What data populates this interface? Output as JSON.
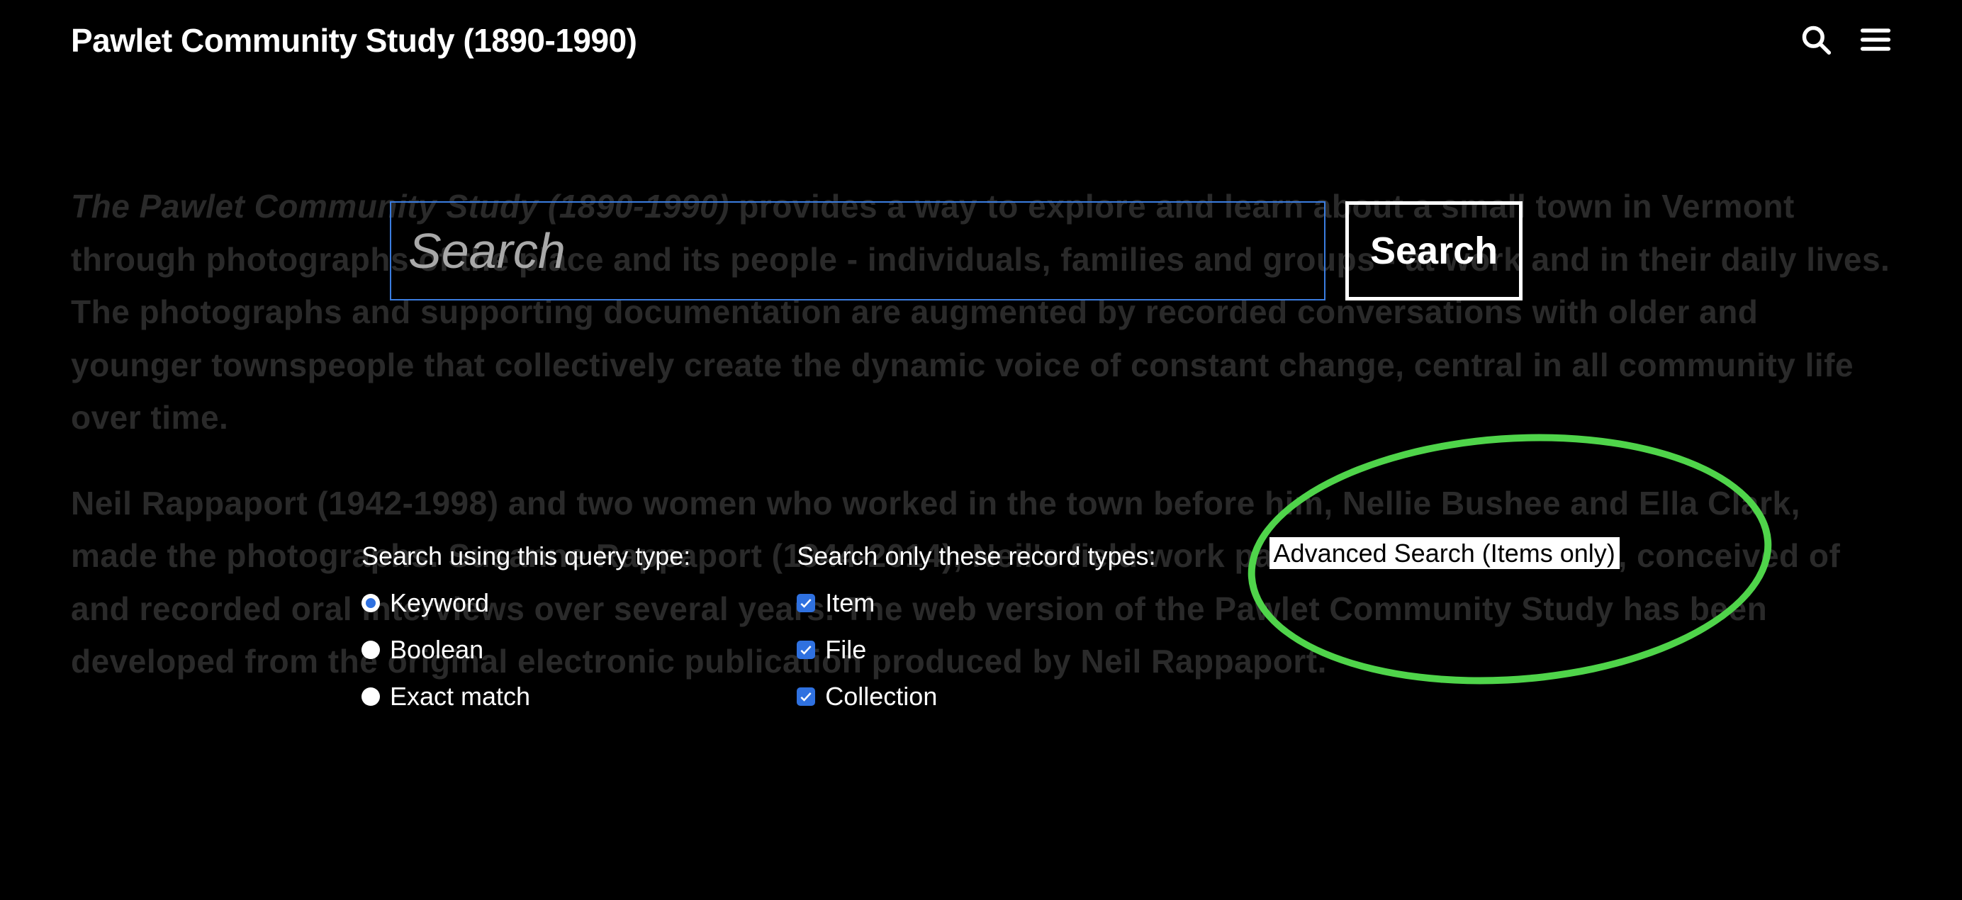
{
  "header": {
    "title": "Pawlet Community Study (1890-1990)"
  },
  "bg": {
    "para1_italic": "The Pawlet Community Study (1890-1990)",
    "para1_rest": " provides a way to explore and learn about a small town in Vermont through photographs of the place and its people - individuals, families and groups - at work and in their daily lives. The photographs and supporting documentation are augmented by recorded conversations with older and younger townspeople that collectively create the dynamic voice of constant change, central in all community life over time.",
    "para2": "Neil Rappaport (1942-1998) and two women who worked in the town before him, Nellie Bushee and Ella Clark, made the photographs. Susanne Rappaport (1944-2014), Neil's field work partner and collaborator, conceived of and recorded oral interviews over several years. The web version of the Pawlet Community Study has been developed from the original electronic publication produced by Neil Rappaport."
  },
  "search": {
    "placeholder": "Search",
    "value": "",
    "button": "Search"
  },
  "query_type": {
    "label": "Search using this query type:",
    "options": [
      {
        "label": "Keyword",
        "selected": true
      },
      {
        "label": "Boolean",
        "selected": false
      },
      {
        "label": "Exact match",
        "selected": false
      }
    ]
  },
  "record_types": {
    "label": "Search only these record types:",
    "options": [
      {
        "label": "Item",
        "checked": true
      },
      {
        "label": "File",
        "checked": true
      },
      {
        "label": "Collection",
        "checked": true
      }
    ]
  },
  "advanced": {
    "label": "Advanced Search (Items only)"
  }
}
